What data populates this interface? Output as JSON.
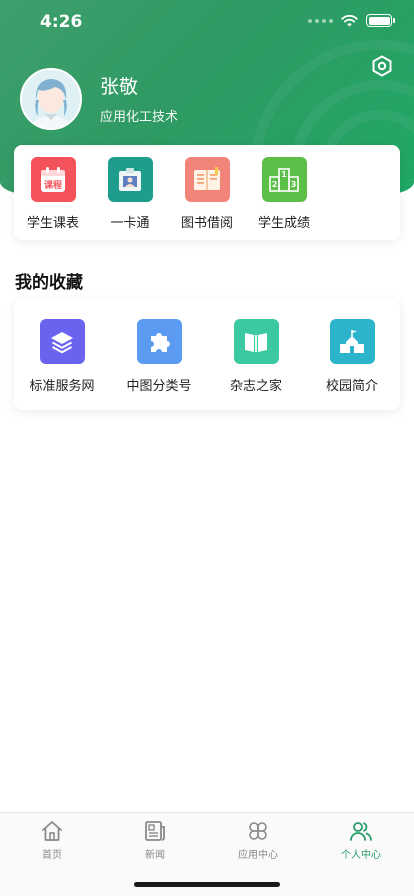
{
  "status_bar": {
    "time": "4:26"
  },
  "profile": {
    "name": "张敬",
    "major": "应用化工技术"
  },
  "quick_actions": [
    {
      "label": "学生课表",
      "icon": "calendar-icon",
      "icon_text": "课程",
      "color": "#f4525a"
    },
    {
      "label": "一卡通",
      "icon": "id-card-icon",
      "color": "#1e9c8c"
    },
    {
      "label": "图书借阅",
      "icon": "book-icon",
      "color": "#f2847a"
    },
    {
      "label": "学生成绩",
      "icon": "podium-icon",
      "icon_text": [
        "1",
        "2",
        "3"
      ],
      "color": "#5cbf48"
    }
  ],
  "favorites_title": "我的收藏",
  "favorites": [
    {
      "label": "标准服务网",
      "icon": "layers-icon",
      "color": "#6a63f0"
    },
    {
      "label": "中图分类号",
      "icon": "puzzle-icon",
      "color": "#5b9cf2"
    },
    {
      "label": "杂志之家",
      "icon": "open-book-icon",
      "color": "#3cc8a0"
    },
    {
      "label": "校园简介",
      "icon": "school-icon",
      "color": "#2cb4cc"
    }
  ],
  "tabs": [
    {
      "label": "首页",
      "icon": "home-icon",
      "active": false
    },
    {
      "label": "新闻",
      "icon": "newspaper-icon",
      "active": false
    },
    {
      "label": "应用中心",
      "icon": "apps-icon",
      "active": false
    },
    {
      "label": "个人中心",
      "icon": "people-icon",
      "active": true
    }
  ],
  "colors": {
    "header": "#2f9a63",
    "active_tab": "#2a9d6a"
  }
}
